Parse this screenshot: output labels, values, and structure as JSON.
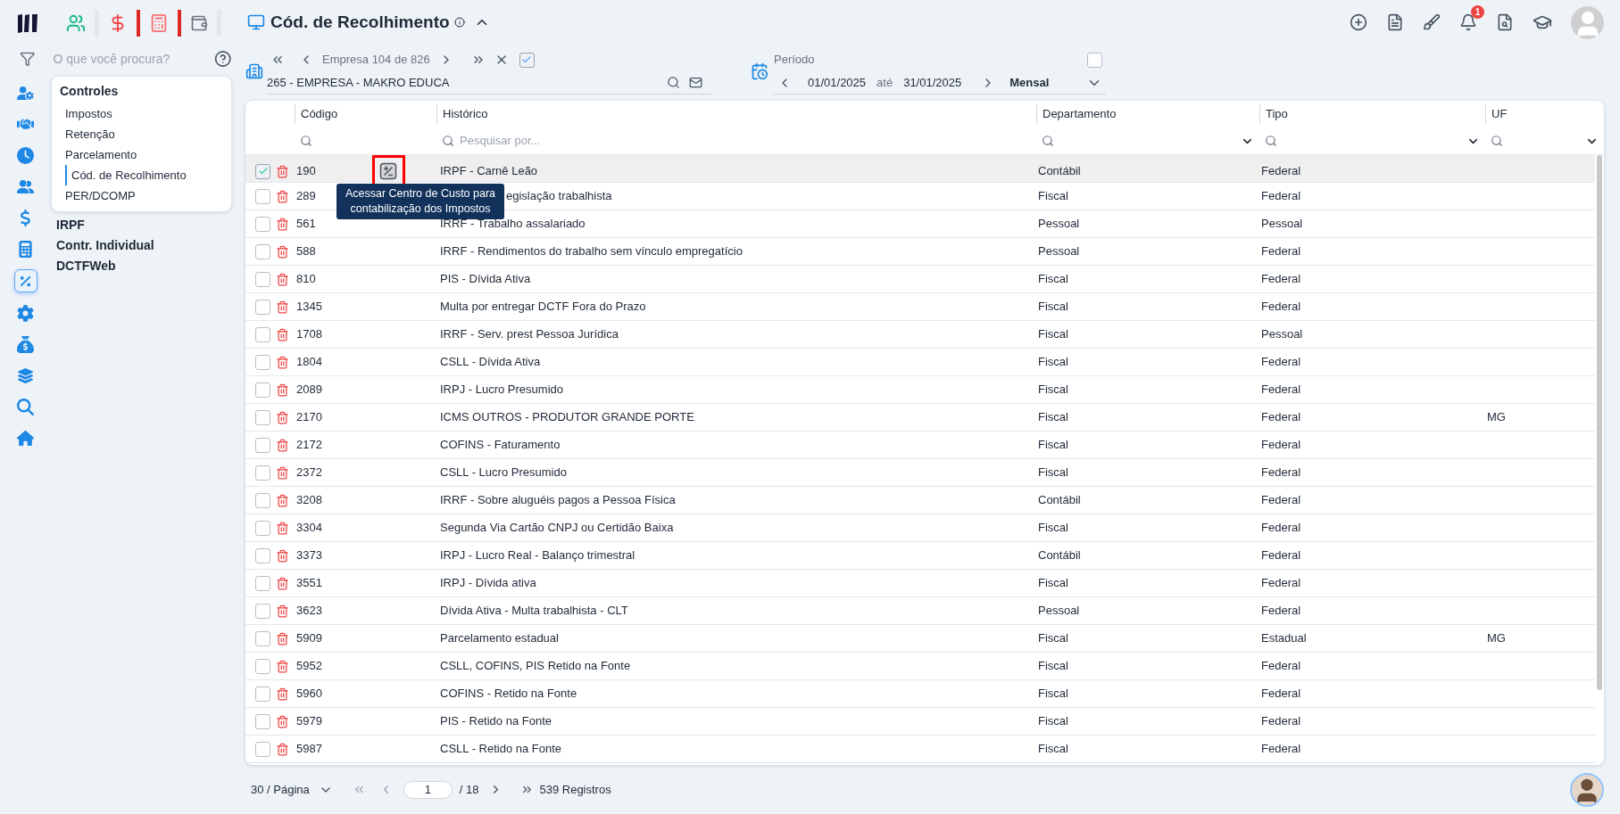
{
  "sidebar": {
    "search_placeholder": "O que você procura?",
    "nav_icons": [
      {
        "selected": false
      },
      {
        "selected": false
      },
      {
        "selected": false
      },
      {
        "selected": false
      },
      {
        "selected": false
      },
      {
        "selected": false
      },
      {
        "selected": true
      },
      {
        "selected": false
      },
      {
        "selected": false
      },
      {
        "selected": false
      },
      {
        "selected": false
      },
      {
        "selected": false
      }
    ],
    "menu": [
      {
        "label": "Controles",
        "expanded": true,
        "items": [
          {
            "label": "Impostos",
            "selected": false
          },
          {
            "label": "Retenção",
            "selected": false
          },
          {
            "label": "Parcelamento",
            "selected": false
          },
          {
            "label": "Cód. de Recolhimento",
            "selected": true
          },
          {
            "label": "PER/DCOMP",
            "selected": false
          }
        ]
      },
      {
        "label": "IRPF",
        "expanded": false
      },
      {
        "label": "Contr. Individual",
        "expanded": false
      },
      {
        "label": "DCTFWeb",
        "expanded": false
      }
    ]
  },
  "page": {
    "title": "Cód. de Recolhimento"
  },
  "notifications_count": "1",
  "company_nav": {
    "position_label": "Empresa 104 de 826",
    "checked": true,
    "company": "265 - EMPRESA - MAKRO EDUCA"
  },
  "period": {
    "label": "Período",
    "checked": false,
    "start": "01/01/2025",
    "separator": "até",
    "end": "31/01/2025",
    "frequency": "Mensal"
  },
  "table": {
    "columns": [
      {
        "label": "Código",
        "kind": "search"
      },
      {
        "label": "Histórico",
        "kind": "search",
        "placeholder": "Pesquisar por..."
      },
      {
        "label": "Departamento",
        "kind": "select"
      },
      {
        "label": "Tipo",
        "kind": "select"
      },
      {
        "label": "UF",
        "kind": "select"
      }
    ],
    "rows": [
      {
        "checked": true,
        "selected": true,
        "codigo": "190",
        "historico": "IRPF - Carnê Leão",
        "departamento": "Contábil",
        "tipo": "Federal"
      },
      {
        "checked": false,
        "selected": false,
        "codigo": "289",
        "historico": "egislação trabalhista",
        "departamento": "Fiscal",
        "tipo": "Federal"
      },
      {
        "checked": false,
        "selected": false,
        "codigo": "561",
        "historico": "IRRF - Trabalho assalariado",
        "departamento": "Pessoal",
        "tipo": "Pessoal"
      },
      {
        "checked": false,
        "selected": false,
        "codigo": "588",
        "historico": "IRRF - Rendimentos do trabalho sem vínculo empregatício",
        "departamento": "Pessoal",
        "tipo": "Federal"
      },
      {
        "checked": false,
        "selected": false,
        "codigo": "810",
        "historico": "PIS - Dívida Ativa",
        "departamento": "Fiscal",
        "tipo": "Federal"
      },
      {
        "checked": false,
        "selected": false,
        "codigo": "1345",
        "historico": "Multa por entregar DCTF Fora do Prazo",
        "departamento": "Fiscal",
        "tipo": "Federal"
      },
      {
        "checked": false,
        "selected": false,
        "codigo": "1708",
        "historico": "IRRF - Serv. prest Pessoa Jurídica",
        "departamento": "Fiscal",
        "tipo": "Pessoal"
      },
      {
        "checked": false,
        "selected": false,
        "codigo": "1804",
        "historico": "CSLL - Dívida Ativa",
        "departamento": "Fiscal",
        "tipo": "Federal"
      },
      {
        "checked": false,
        "selected": false,
        "codigo": "2089",
        "historico": "IRPJ - Lucro Presumido",
        "departamento": "Fiscal",
        "tipo": "Federal"
      },
      {
        "checked": false,
        "selected": false,
        "codigo": "2170",
        "historico": "ICMS OUTROS - PRODUTOR GRANDE PORTE",
        "departamento": "Fiscal",
        "tipo": "Federal",
        "uf": "MG"
      },
      {
        "checked": false,
        "selected": false,
        "codigo": "2172",
        "historico": "COFINS - Faturamento",
        "departamento": "Fiscal",
        "tipo": "Federal"
      },
      {
        "checked": false,
        "selected": false,
        "codigo": "2372",
        "historico": "CSLL - Lucro Presumido",
        "departamento": "Fiscal",
        "tipo": "Federal"
      },
      {
        "checked": false,
        "selected": false,
        "codigo": "3208",
        "historico": "IRRF - Sobre aluguéis pagos a Pessoa Física",
        "departamento": "Contábil",
        "tipo": "Federal"
      },
      {
        "checked": false,
        "selected": false,
        "codigo": "3304",
        "historico": "Segunda Via Cartão CNPJ ou Certidão Baixa",
        "departamento": "Fiscal",
        "tipo": "Federal"
      },
      {
        "checked": false,
        "selected": false,
        "codigo": "3373",
        "historico": "IRPJ - Lucro Real - Balanço trimestral",
        "departamento": "Contábil",
        "tipo": "Federal"
      },
      {
        "checked": false,
        "selected": false,
        "codigo": "3551",
        "historico": "IRPJ - Dívida ativa",
        "departamento": "Fiscal",
        "tipo": "Federal"
      },
      {
        "checked": false,
        "selected": false,
        "codigo": "3623",
        "historico": "Dívida Ativa - Multa trabalhista - CLT",
        "departamento": "Pessoal",
        "tipo": "Federal"
      },
      {
        "checked": false,
        "selected": false,
        "codigo": "5909",
        "historico": "Parcelamento estadual",
        "departamento": "Fiscal",
        "tipo": "Estadual",
        "uf": "MG"
      },
      {
        "checked": false,
        "selected": false,
        "codigo": "5952",
        "historico": "CSLL, COFINS, PIS Retido na Fonte",
        "departamento": "Fiscal",
        "tipo": "Federal"
      },
      {
        "checked": false,
        "selected": false,
        "codigo": "5960",
        "historico": "COFINS - Retido na Fonte",
        "departamento": "Fiscal",
        "tipo": "Federal"
      },
      {
        "checked": false,
        "selected": false,
        "codigo": "5979",
        "historico": "PIS - Retido na Fonte",
        "departamento": "Fiscal",
        "tipo": "Federal"
      },
      {
        "checked": false,
        "selected": false,
        "codigo": "5987",
        "historico": "CSLL - Retido na Fonte",
        "departamento": "Fiscal",
        "tipo": "Federal"
      }
    ]
  },
  "tooltip": "Acessar Centro de Custo para contabilização dos Impostos",
  "pagination": {
    "page_size": "30 / Página",
    "page": "1",
    "total_pages": "/ 18",
    "records": "539 Registros"
  }
}
